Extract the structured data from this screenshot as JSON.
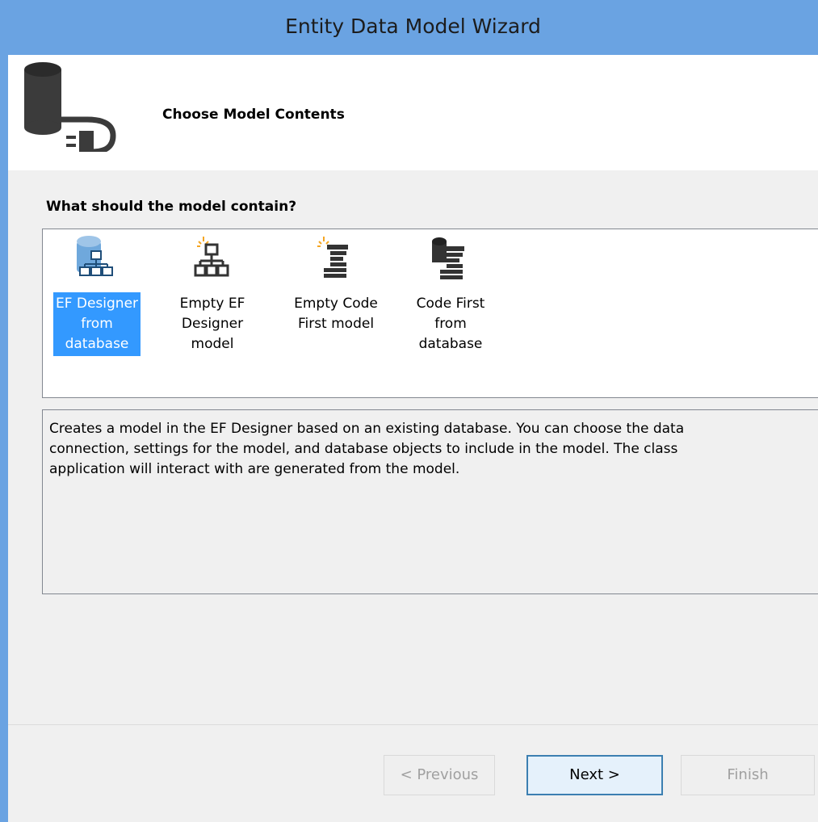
{
  "window": {
    "title": "Entity Data Model Wizard"
  },
  "header": {
    "title": "Choose Model Contents",
    "icon": "database-connection-icon"
  },
  "question": "What should the model contain?",
  "items": [
    {
      "label": "EF Designer\nfrom\ndatabase",
      "icon": "database-designer-icon",
      "selected": true
    },
    {
      "label": "Empty EF\nDesigner\nmodel",
      "icon": "empty-designer-icon",
      "selected": false
    },
    {
      "label": "Empty Code\nFirst model",
      "icon": "empty-code-first-icon",
      "selected": false
    },
    {
      "label": "Code First\nfrom\ndatabase",
      "icon": "code-first-database-icon",
      "selected": false
    }
  ],
  "description": [
    "Creates a model in the EF Designer based on an existing database. You can choose the data",
    "connection, settings for the model, and database objects to include in the model. The class",
    "application will interact with are generated from the model."
  ],
  "buttons": {
    "previous": {
      "label": "< Previous",
      "enabled": false
    },
    "next": {
      "label": "Next >",
      "enabled": true
    },
    "finish": {
      "label": "Finish",
      "enabled": false
    }
  },
  "colors": {
    "titlebar": "#6aa3e2",
    "selection": "#3399ff",
    "dialog_bg": "#f0f0f0"
  }
}
